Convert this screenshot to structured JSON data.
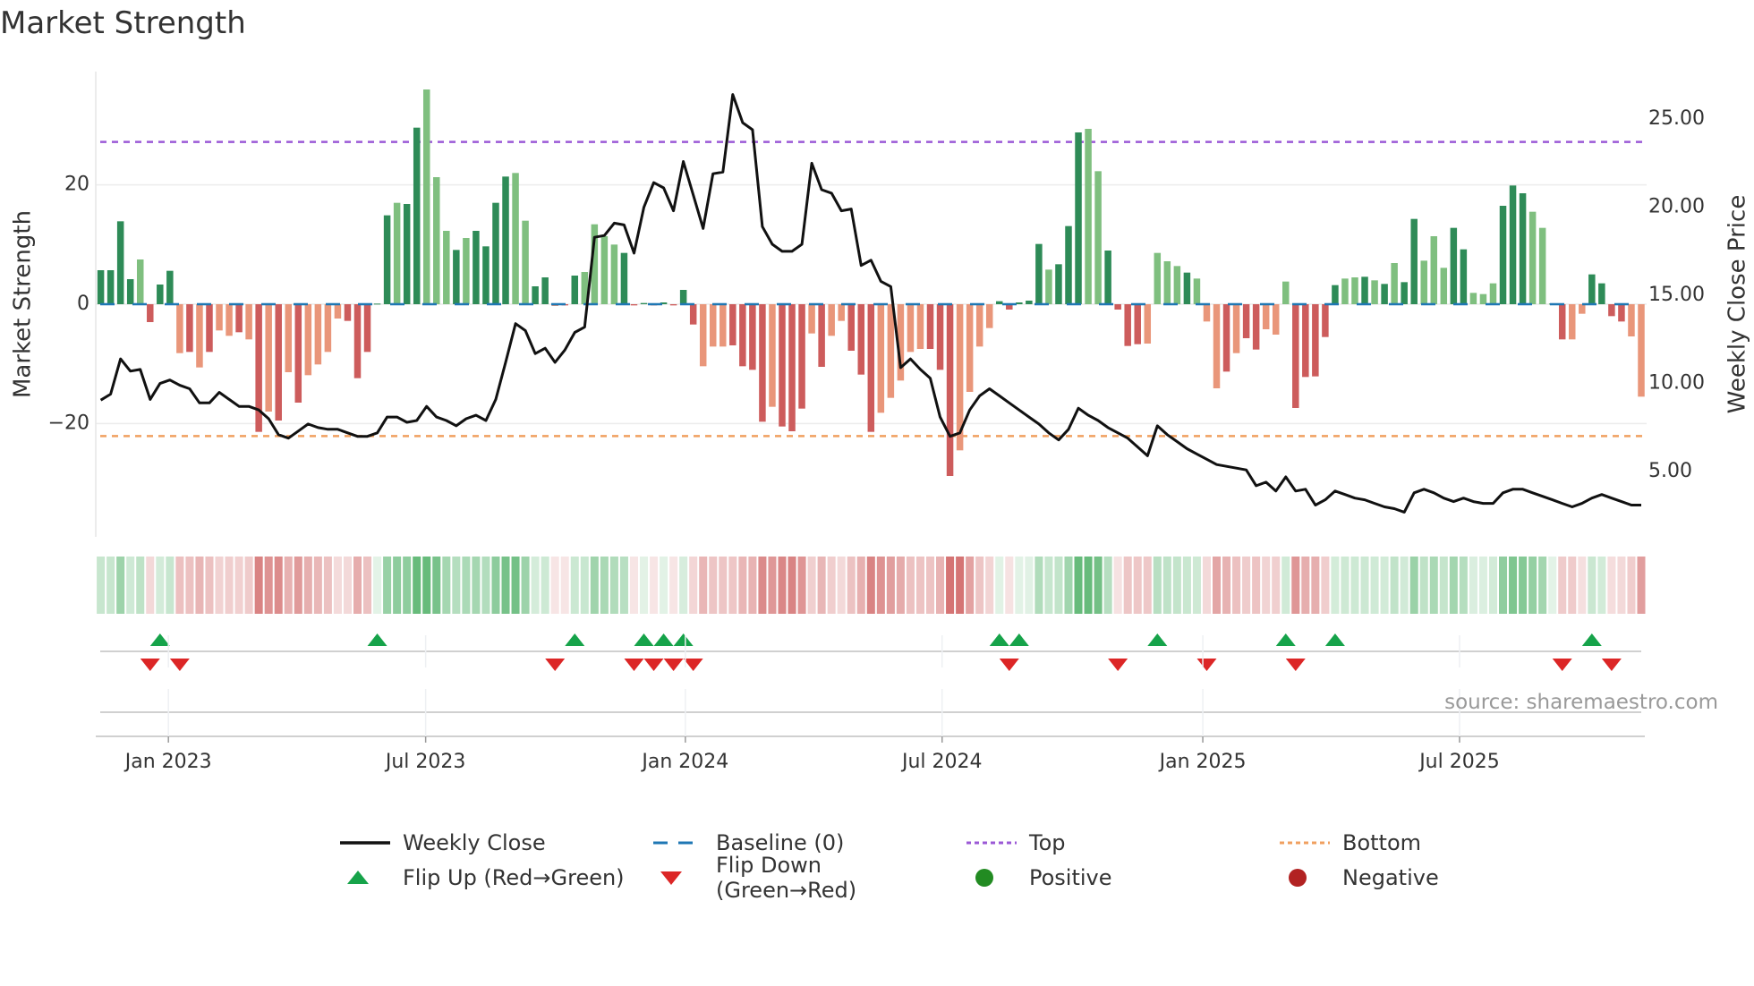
{
  "title": "Market Strength",
  "source": "source: sharemaestro.com",
  "legend": {
    "weekly_close": "Weekly Close",
    "baseline": "Baseline (0)",
    "top": "Top",
    "bottom": "Bottom",
    "flip_up": "Flip Up (Red→Green)",
    "flip_down": "Flip Down (Green→Red)",
    "positive": "Positive",
    "negative": "Negative"
  },
  "colors": {
    "pos_strong": "#2e8b57",
    "pos_weak": "#7fbf7f",
    "neg_strong": "#cd5c5c",
    "neg_weak": "#e9967a",
    "price": "#111111",
    "baseline": "#1f77b4",
    "top": "#9b59d6",
    "bottom": "#f0a060",
    "flip_up": "#16a34a",
    "flip_down": "#dc2626",
    "positive": "#228b22",
    "negative": "#b22222"
  },
  "chart_data": {
    "type": "bar",
    "title": "Market Strength",
    "ylabel": "Market Strength",
    "y2label": "Weekly Close Price",
    "ylim": [
      -39,
      39
    ],
    "y2lim": [
      1.3,
      27.7
    ],
    "yticks": [
      {
        "v": 20,
        "label": "20"
      },
      {
        "v": 0,
        "label": "0"
      },
      {
        "v": -20,
        "label": "−20"
      }
    ],
    "y2ticks": [
      {
        "v": 25,
        "label": "25.00"
      },
      {
        "v": 20,
        "label": "20.00"
      },
      {
        "v": 15,
        "label": "15.00"
      },
      {
        "v": 10,
        "label": "10.00"
      },
      {
        "v": 5,
        "label": "5.00"
      }
    ],
    "xticks": [
      {
        "week": 6.85,
        "label": "Jan 2023"
      },
      {
        "week": 32.9,
        "label": "Jul 2023"
      },
      {
        "week": 59.2,
        "label": "Jan 2024"
      },
      {
        "week": 85.2,
        "label": "Jul 2024"
      },
      {
        "week": 111.6,
        "label": "Jan 2025"
      },
      {
        "week": 137.6,
        "label": "Jul 2025"
      }
    ],
    "top": 27.2,
    "bottom": -22.1,
    "strength": [
      5.7,
      5.7,
      13.9,
      4.2,
      7.5,
      -3,
      3.3,
      5.6,
      -8.2,
      -8,
      -10.6,
      -8,
      -4.4,
      -5.3,
      -4.7,
      -5.9,
      -21.4,
      -18,
      -19.5,
      -11.4,
      -16.5,
      -11.9,
      -10.1,
      -8,
      -2.4,
      -2.8,
      -12.4,
      -8,
      0.1,
      14.9,
      17,
      16.8,
      29.6,
      36,
      21.3,
      12.3,
      9.1,
      11.1,
      12.3,
      9.7,
      17,
      21.4,
      22,
      14,
      3,
      4.5,
      -0.3,
      -0.2,
      4.8,
      5.4,
      13.4,
      11.4,
      10,
      8.6,
      -0.2,
      0.2,
      -0.2,
      0.3,
      -0.2,
      2.4,
      -3.4,
      -10.4,
      -7.1,
      -7.1,
      -6.9,
      -10.4,
      -11,
      -19.7,
      -17.2,
      -20.5,
      -21.3,
      -17.5,
      -4.9,
      -10.5,
      -5.3,
      -2.8,
      -7.8,
      -11.8,
      -21.4,
      -18.2,
      -15.7,
      -12.8,
      -8,
      -7.5,
      -7.5,
      -11,
      -28.8,
      -24.5,
      -14.7,
      -7.1,
      -4,
      0.5,
      -0.9,
      0.3,
      0.6,
      10.1,
      5.8,
      6.7,
      13.1,
      28.8,
      29.4,
      22.3,
      9,
      -0.9,
      -7,
      -6.7,
      -6.6,
      8.6,
      7.2,
      6.4,
      5.3,
      4.3,
      -2.9,
      -14.1,
      -11.3,
      -8.2,
      -5.7,
      -7.6,
      -4.2,
      -5.1,
      3.8,
      -17.4,
      -12.2,
      -12.1,
      -5.5,
      3.2,
      4.3,
      4.5,
      4.6,
      4,
      3.4,
      6.9,
      3.7,
      14.3,
      7.3,
      11.4,
      6.1,
      12.8,
      9.2,
      1.9,
      1.7,
      3.5,
      16.5,
      19.9,
      18.6,
      15.5,
      12.8,
      0.1,
      -5.9,
      -5.9,
      -1.6,
      5,
      3.5,
      -2,
      -2.9,
      -5.4,
      -15.5
    ],
    "strong": "ddddldddldldlldldldldlllldddddlddllldlddddllddlddllllddddddddlllddddldddldlldddllllldddlllldddddldddllddddlllldllldlddllldddddlldldlddlllddllldddllddlldddd",
    "weekly_close": [
      9.06,
      9.4,
      11.4,
      10.7,
      10.8,
      9.1,
      10.0,
      10.2,
      9.9,
      9.7,
      8.9,
      8.9,
      9.5,
      9.1,
      8.7,
      8.7,
      8.5,
      8.0,
      7.1,
      6.9,
      7.3,
      7.7,
      7.5,
      7.4,
      7.4,
      7.2,
      7.0,
      7.0,
      7.2,
      8.1,
      8.1,
      7.8,
      7.9,
      8.7,
      8.1,
      7.9,
      7.6,
      8.0,
      8.2,
      7.9,
      9.1,
      11.2,
      13.4,
      13.0,
      11.7,
      12.0,
      11.2,
      11.9,
      12.9,
      13.2,
      18.3,
      18.4,
      19.1,
      19.0,
      17.4,
      20.0,
      21.4,
      21.1,
      19.8,
      22.6,
      20.7,
      18.8,
      21.9,
      22.0,
      26.4,
      24.8,
      24.4,
      18.9,
      17.9,
      17.5,
      17.5,
      17.9,
      22.5,
      21.0,
      20.8,
      19.8,
      19.9,
      16.7,
      17.0,
      15.8,
      15.5,
      10.9,
      11.4,
      10.8,
      10.3,
      8.1,
      7.0,
      7.2,
      8.5,
      9.3,
      9.7,
      9.3,
      8.9,
      8.5,
      8.1,
      7.7,
      7.2,
      6.8,
      7.4,
      8.6,
      8.2,
      7.9,
      7.5,
      7.2,
      6.9,
      6.4,
      5.9,
      7.6,
      7.1,
      6.7,
      6.3,
      6.0,
      5.7,
      5.4,
      5.3,
      5.2,
      5.1,
      4.2,
      4.4,
      3.9,
      4.7,
      3.9,
      4.0,
      3.1,
      3.4,
      3.9,
      3.7,
      3.5,
      3.4,
      3.2,
      3.0,
      2.9,
      2.7,
      3.8,
      4.0,
      3.8,
      3.5,
      3.3,
      3.5,
      3.3,
      3.2,
      3.2,
      3.8,
      4.0,
      4.0,
      3.8,
      3.6,
      3.4,
      3.2,
      3.0,
      3.2,
      3.5,
      3.7,
      3.5,
      3.3,
      3.1,
      3.1
    ],
    "flip_up_weeks": [
      6,
      28,
      48,
      55,
      57,
      59,
      91,
      93,
      107,
      120,
      125,
      151
    ],
    "flip_down_weeks": [
      5,
      8,
      46,
      54,
      56,
      58,
      60,
      92,
      103,
      112,
      121,
      148,
      153
    ]
  }
}
